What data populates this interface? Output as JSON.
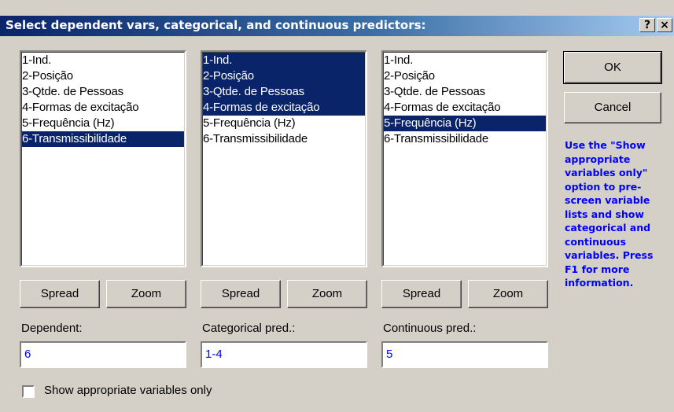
{
  "window": {
    "title": "Select dependent vars, categorical, and continuous predictors:",
    "help_btn": "?",
    "close_btn": "×"
  },
  "lists": [
    {
      "items": [
        "1-Ind.",
        "2-Posição",
        "3-Qtde. de Pessoas",
        "4-Formas de excitação",
        "5-Frequência (Hz)",
        "6-Transmissibilidade"
      ],
      "selected": [
        6
      ]
    },
    {
      "items": [
        "1-Ind.",
        "2-Posição",
        "3-Qtde. de Pessoas",
        "4-Formas de excitação",
        "5-Frequência (Hz)",
        "6-Transmissibilidade"
      ],
      "selected": [
        1,
        2,
        3,
        4
      ]
    },
    {
      "items": [
        "1-Ind.",
        "2-Posição",
        "3-Qtde. de Pessoas",
        "4-Formas de excitação",
        "5-Frequência (Hz)",
        "6-Transmissibilidade"
      ],
      "selected": [
        5
      ]
    }
  ],
  "buttons": {
    "spread": "Spread",
    "zoom": "Zoom",
    "ok": "OK",
    "cancel": "Cancel"
  },
  "fields": {
    "dependent_label": "Dependent:",
    "dependent_value": "6",
    "categorical_label": "Categorical pred.:",
    "categorical_value": "1-4",
    "continuous_label": "Continuous pred.:",
    "continuous_value": "5"
  },
  "help_text": "Use the \"Show appropriate variables only\" option to pre-screen variable lists and show categorical and continuous variables. Press F1 for more information.",
  "checkbox": {
    "label": "Show appropriate variables only",
    "checked": false
  },
  "colors": {
    "selection": "#0a246a",
    "help_text": "#0000ff",
    "dialog_bg": "#d4d0c8"
  }
}
